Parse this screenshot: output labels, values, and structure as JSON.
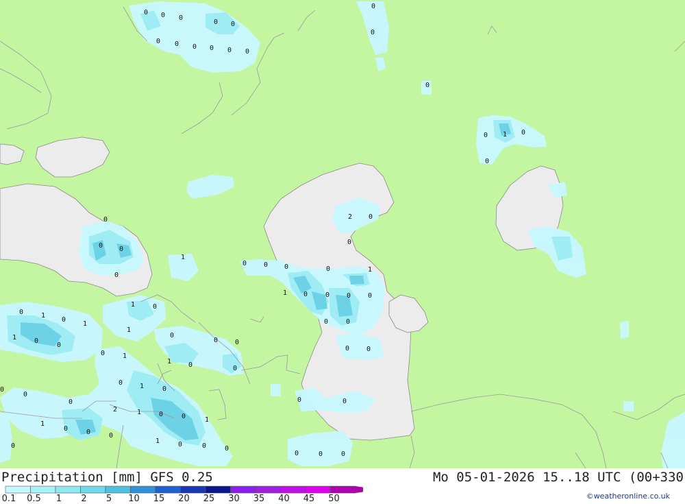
{
  "header": {
    "title": "Precipitation [mm] GFS 0.25",
    "validity": "Mo 05-01-2026 15..18 UTC (00+330",
    "credit": "©weatheronline.co.uk"
  },
  "legend": {
    "labels": [
      "0.1",
      "0.5",
      "1",
      "2",
      "5",
      "10",
      "15",
      "20",
      "25",
      "30",
      "35",
      "40",
      "45",
      "50"
    ],
    "colors": [
      "#c8f8ff",
      "#a8f0fa",
      "#8ee8f0",
      "#70d8e8",
      "#50c0e0",
      "#3090d8",
      "#2060d0",
      "#1838b8",
      "#0a1890",
      "#8a20f0",
      "#a020e0",
      "#c010e8",
      "#e000f0",
      "#b000b0"
    ]
  },
  "map": {
    "colors": {
      "land": "#c4f5a0",
      "water": "#ececec",
      "precip_light": "#c8f8ff",
      "precip_mid": "#a0ecf4",
      "precip_heavy": "#6ed2e6"
    },
    "values": [
      "0",
      "0",
      "0",
      "0",
      "0",
      "0",
      "0",
      "0",
      "0",
      "0",
      "0",
      "0",
      "0",
      "0",
      "0",
      "1",
      "0",
      "0",
      "0",
      "0",
      "0",
      "0",
      "1",
      "2",
      "0",
      "0",
      "0",
      "0",
      "0",
      "0",
      "1",
      "1",
      "0",
      "0",
      "0",
      "0",
      "0",
      "0",
      "0",
      "0",
      "1",
      "0",
      "0",
      "1",
      "0",
      "1",
      "1",
      "1",
      "0",
      "0",
      "0",
      "1",
      "0",
      "0",
      "0",
      "1",
      "0",
      "0",
      "0",
      "1",
      "0",
      "0",
      "0",
      "0",
      "2",
      "1",
      "0",
      "0",
      "1",
      "1",
      "0",
      "0",
      "0",
      "1",
      "0",
      "0",
      "0",
      "0",
      "0",
      "0",
      "0",
      "0",
      "0"
    ]
  }
}
